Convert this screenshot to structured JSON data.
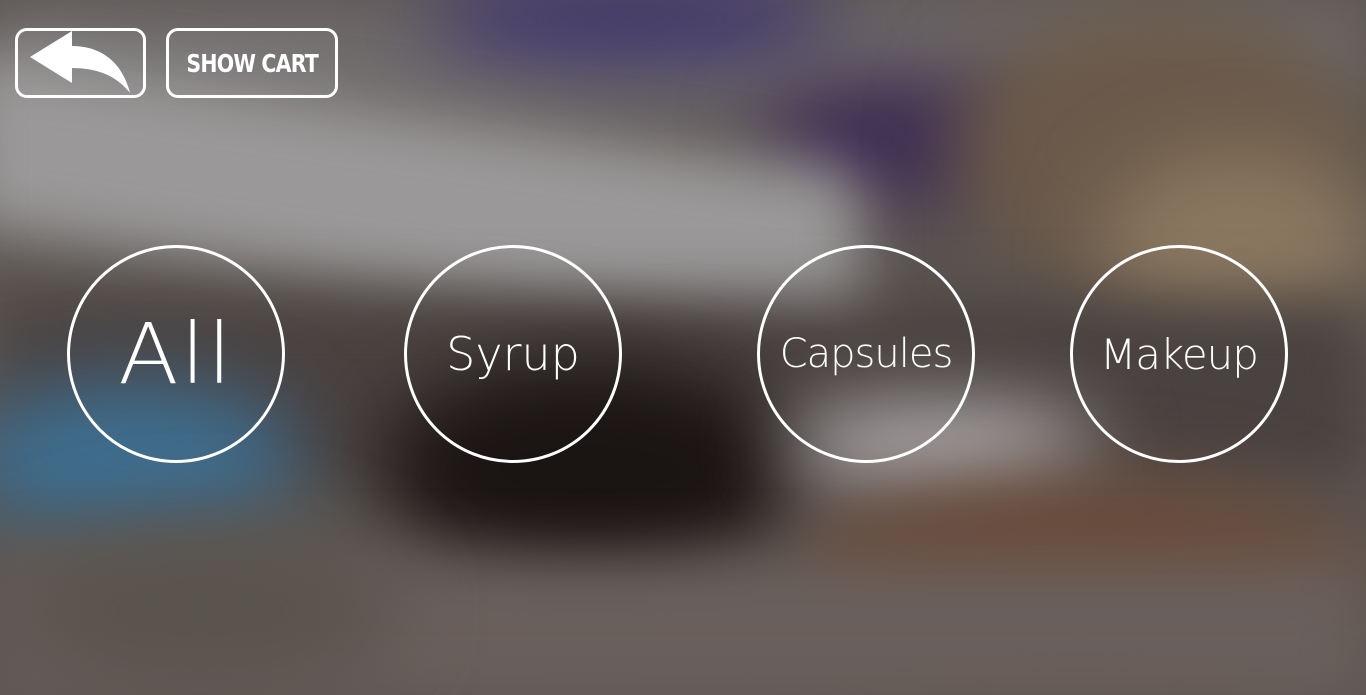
{
  "header": {
    "back_icon": "back-arrow-icon",
    "show_cart_label": "SHOW CART"
  },
  "categories": [
    {
      "label": "All"
    },
    {
      "label": "Syrup"
    },
    {
      "label": "Capsules"
    },
    {
      "label": "Makeup"
    }
  ],
  "colors": {
    "button_border": "#ffffff",
    "text": "#ffffff"
  }
}
